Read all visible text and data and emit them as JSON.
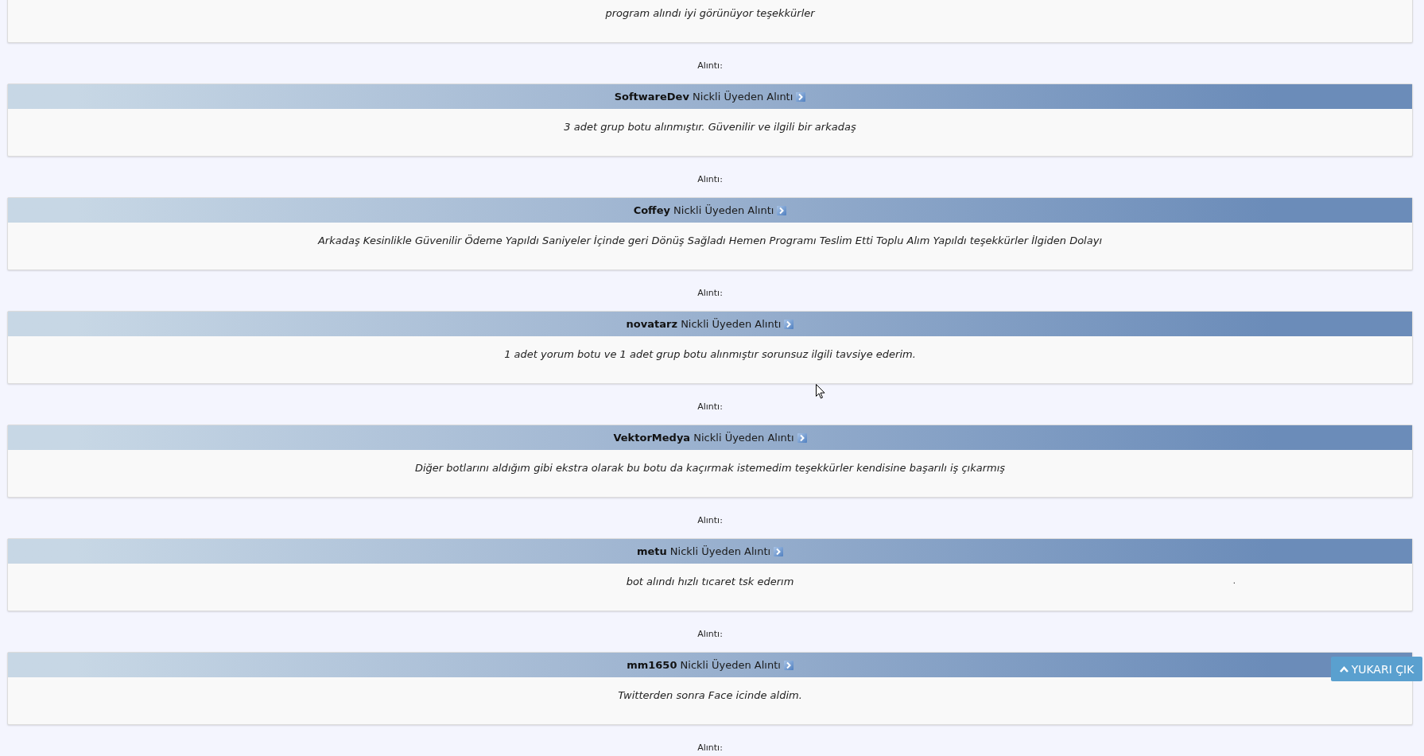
{
  "top_card": {
    "text": "program alındı iyi görünüyor teşekkürler"
  },
  "quotes": [
    {
      "label": "Alıntı:",
      "author": "SoftwareDev",
      "suffix": "Nickli Üyeden Alıntı",
      "text": "3 adet grup botu alınmıştır. Güvenilir ve ilgili bir arkadaş"
    },
    {
      "label": "Alıntı:",
      "author": "Coffey",
      "suffix": "Nickli Üyeden Alıntı",
      "text": "Arkadaş Kesinlikle Güvenilir Ödeme Yapıldı Saniyeler İçinde geri Dönüş Sağladı Hemen Programı Teslim Etti Toplu Alım Yapıldı teşekkürler İlgiden Dolayı"
    },
    {
      "label": "Alıntı:",
      "author": "novatarz",
      "suffix": "Nickli Üyeden Alıntı",
      "text": "1 adet yorum botu ve 1 adet grup botu alınmıştır sorunsuz ilgili tavsiye ederim."
    },
    {
      "label": "Alıntı:",
      "author": "VektorMedya",
      "suffix": "Nickli Üyeden Alıntı",
      "text": "Diğer botlarını aldığım gibi ekstra olarak bu botu da kaçırmak istemedim teşekkürler kendisine başarılı iş çıkarmış"
    },
    {
      "label": "Alıntı:",
      "author": "metu",
      "suffix": "Nickli Üyeden Alıntı",
      "text": "bot alındı hızlı tıcaret tsk ederım",
      "mark": "."
    },
    {
      "label": "Alıntı:",
      "author": "mm1650",
      "suffix": "Nickli Üyeden Alıntı",
      "text": "Twitterden sonra Face icinde aldim."
    }
  ],
  "trailing_label": "Alıntı:",
  "scroll_top_button": {
    "label": "YUKARI ÇIK"
  }
}
